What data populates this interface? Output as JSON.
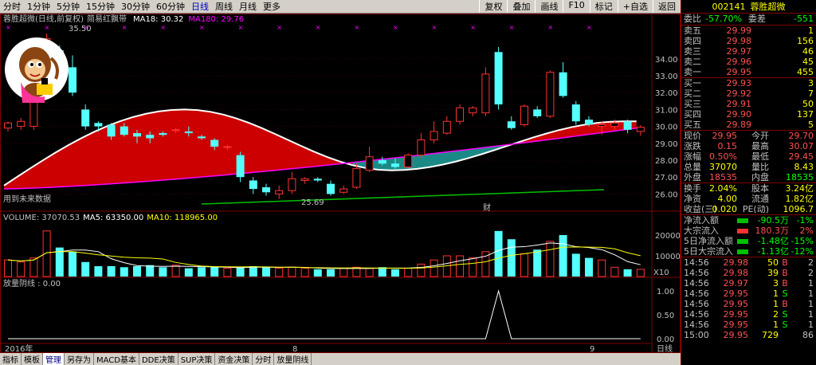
{
  "topbar": {
    "periods": [
      "分时",
      "1分钟",
      "5分钟",
      "15分钟",
      "30分钟",
      "60分钟",
      "日线",
      "周线",
      "月线",
      "更多"
    ],
    "active_period": "日线",
    "tools": [
      "复权",
      "叠加",
      "画线",
      "F10",
      "标记",
      "+自选",
      "返回"
    ]
  },
  "main_title": {
    "name": "蓉胜超微(日线,前复权)",
    "indicator": "简易红飘带",
    "ma18_label": "MA18: 30.32",
    "ma180_label": "MA180: 29.76"
  },
  "chart_labels": {
    "high_marker": "35.50",
    "low_marker": "25.69",
    "future_text": "用到未来数据",
    "cai_mark": "财",
    "volume_header": "VOLUME: 37070.53",
    "vol_ma5": "MA5: 63350.00",
    "vol_ma10": "MA10: 118965.00",
    "vol_unit": "X10",
    "ind_header": "放量阴线 : 0.00",
    "year_label": "2016年",
    "month_label_1": "8",
    "month_label_2": "9",
    "period_box": "日线"
  },
  "bottom_tabs": [
    "指标",
    "模板",
    "管理",
    "另存为",
    "MACD基本",
    "DDE决策",
    "SUP决策",
    "资金决策",
    "分时",
    "放量阴线"
  ],
  "active_tab": "管理",
  "colors": {
    "up": "#ff3232",
    "down": "#54ffff",
    "ribbon_red": "#cc0000",
    "ribbon_teal": "#1b8a87"
  },
  "quote": {
    "code": "002141",
    "name": "蓉胜超微",
    "weibi_label": "委比",
    "weibi_value": "-57.70%",
    "weicha_label": "委差",
    "weicha_value": "-551",
    "asks": [
      {
        "label": "卖五",
        "price": "29.99",
        "vol": "1"
      },
      {
        "label": "卖四",
        "price": "29.98",
        "vol": "156"
      },
      {
        "label": "卖三",
        "price": "29.97",
        "vol": "46"
      },
      {
        "label": "卖二",
        "price": "29.96",
        "vol": "45"
      },
      {
        "label": "卖一",
        "price": "29.95",
        "vol": "455"
      }
    ],
    "bids": [
      {
        "label": "买一",
        "price": "29.93",
        "vol": "3"
      },
      {
        "label": "买二",
        "price": "29.92",
        "vol": "7"
      },
      {
        "label": "买三",
        "price": "29.91",
        "vol": "50"
      },
      {
        "label": "买四",
        "price": "29.90",
        "vol": "137"
      },
      {
        "label": "买五",
        "price": "29.89",
        "vol": "5"
      }
    ],
    "stats": [
      {
        "l1": "现价",
        "v1": "29.95",
        "l2": "今开",
        "v2": "29.70"
      },
      {
        "l1": "涨跌",
        "v1": "0.15",
        "l2": "最高",
        "v2": "30.07"
      },
      {
        "l1": "涨幅",
        "v1": "0.50%",
        "l2": "最低",
        "v2": "29.45"
      },
      {
        "l1": "总量",
        "v1": "37070",
        "l2": "量比",
        "v2": "8.43"
      },
      {
        "l1": "外盘",
        "v1": "18535",
        "l2": "内盘",
        "v2": "18535"
      }
    ],
    "stats2": [
      {
        "l1": "换手",
        "v1": "2.04%",
        "l2": "股本",
        "v2": "3.24亿"
      },
      {
        "l1": "净资",
        "v1": "4.00",
        "l2": "流通",
        "v2": "1.82亿"
      },
      {
        "l1": "收益(三)",
        "v1": "0.020",
        "l2": "PE(动)",
        "v2": "1096.7"
      }
    ],
    "flows": [
      {
        "label": "净流入额",
        "value": "-90.5万",
        "pct": "-1%"
      },
      {
        "label": "大宗流入",
        "value": "180.3万",
        "pct": "2%"
      },
      {
        "label": "5日净流入额",
        "value": "-1.48亿",
        "pct": "-15%"
      },
      {
        "label": "5日大宗流入",
        "value": "-1.13亿",
        "pct": "-12%"
      }
    ],
    "ticks": [
      {
        "time": "14:56",
        "price": "29.98",
        "vol": "50",
        "bs": "B",
        "n": "2"
      },
      {
        "time": "14:56",
        "price": "29.98",
        "vol": "39",
        "bs": "B",
        "n": "2"
      },
      {
        "time": "14:56",
        "price": "29.97",
        "vol": "3",
        "bs": "B",
        "n": "1"
      },
      {
        "time": "14:56",
        "price": "29.95",
        "vol": "1",
        "bs": "S",
        "n": "1"
      },
      {
        "time": "14:56",
        "price": "29.95",
        "vol": "1",
        "bs": "B",
        "n": "1"
      },
      {
        "time": "14:56",
        "price": "29.95",
        "vol": "2",
        "bs": "S",
        "n": "1"
      },
      {
        "time": "14:56",
        "price": "29.95",
        "vol": "1",
        "bs": "S",
        "n": "1"
      },
      {
        "time": "15:00",
        "price": "29.95",
        "vol": "729",
        "bs": "",
        "n": "86"
      }
    ]
  },
  "chart_data": {
    "type": "candlestick",
    "price_axis": [
      34.0,
      33.0,
      32.0,
      31.0,
      30.0,
      29.0,
      28.0,
      27.0,
      26.0
    ],
    "volume_axis": [
      20000,
      10000
    ],
    "indicator_axis": [
      1.0,
      0.5,
      0.0
    ],
    "candles": [
      {
        "o": 29.9,
        "c": 30.2,
        "h": 30.3,
        "l": 29.7
      },
      {
        "o": 30.0,
        "c": 30.3,
        "h": 30.5,
        "l": 29.8
      },
      {
        "o": 30.0,
        "c": 34.0,
        "h": 34.5,
        "l": 29.8
      },
      {
        "o": 34.5,
        "c": 35.2,
        "h": 35.5,
        "l": 33.5
      },
      {
        "o": 34.5,
        "c": 32.5,
        "h": 34.8,
        "l": 32.2
      },
      {
        "o": 33.5,
        "c": 32.0,
        "h": 34.2,
        "l": 31.8
      },
      {
        "o": 31.0,
        "c": 30.0,
        "h": 31.3,
        "l": 29.8
      },
      {
        "o": 30.2,
        "c": 30.0,
        "h": 30.3,
        "l": 29.7
      },
      {
        "o": 30.1,
        "c": 29.4,
        "h": 30.2,
        "l": 29.2
      },
      {
        "o": 30.0,
        "c": 29.5,
        "h": 30.2,
        "l": 29.4
      },
      {
        "o": 29.6,
        "c": 29.4,
        "h": 29.8,
        "l": 29.0
      },
      {
        "o": 29.5,
        "c": 29.3,
        "h": 29.7,
        "l": 29.0
      },
      {
        "o": 29.6,
        "c": 29.5,
        "h": 29.7,
        "l": 29.4
      },
      {
        "o": 29.8,
        "c": 29.8,
        "h": 29.9,
        "l": 29.6
      },
      {
        "o": 29.7,
        "c": 29.6,
        "h": 30.0,
        "l": 29.4
      },
      {
        "o": 29.4,
        "c": 29.3,
        "h": 29.5,
        "l": 29.2
      },
      {
        "o": 29.2,
        "c": 28.8,
        "h": 29.3,
        "l": 28.6
      },
      {
        "o": 28.8,
        "c": 28.8,
        "h": 28.9,
        "l": 28.6
      },
      {
        "o": 28.3,
        "c": 27.0,
        "h": 28.5,
        "l": 26.7
      },
      {
        "o": 26.8,
        "c": 26.3,
        "h": 27.0,
        "l": 26.0
      },
      {
        "o": 26.4,
        "c": 26.1,
        "h": 26.6,
        "l": 25.9
      },
      {
        "o": 26.0,
        "c": 26.2,
        "h": 26.5,
        "l": 25.7
      },
      {
        "o": 26.2,
        "c": 26.9,
        "h": 27.3,
        "l": 26.0
      },
      {
        "o": 26.8,
        "c": 26.9,
        "h": 27.0,
        "l": 26.6
      },
      {
        "o": 26.9,
        "c": 26.8,
        "h": 27.0,
        "l": 26.7
      },
      {
        "o": 26.6,
        "c": 26.0,
        "h": 26.8,
        "l": 25.9
      },
      {
        "o": 26.1,
        "c": 26.3,
        "h": 26.5,
        "l": 26.0
      },
      {
        "o": 26.4,
        "c": 27.5,
        "h": 27.8,
        "l": 26.3
      },
      {
        "o": 27.4,
        "c": 28.2,
        "h": 28.8,
        "l": 27.3
      },
      {
        "o": 28.0,
        "c": 27.8,
        "h": 28.2,
        "l": 27.7
      },
      {
        "o": 27.8,
        "c": 27.6,
        "h": 28.1,
        "l": 27.5
      },
      {
        "o": 27.6,
        "c": 28.3,
        "h": 28.4,
        "l": 27.5
      },
      {
        "o": 28.3,
        "c": 29.2,
        "h": 29.6,
        "l": 28.1
      },
      {
        "o": 29.2,
        "c": 29.7,
        "h": 30.3,
        "l": 29.0
      },
      {
        "o": 29.6,
        "c": 30.3,
        "h": 30.6,
        "l": 29.5
      },
      {
        "o": 30.3,
        "c": 31.1,
        "h": 31.3,
        "l": 30.1
      },
      {
        "o": 30.8,
        "c": 31.1,
        "h": 31.2,
        "l": 30.6
      },
      {
        "o": 30.8,
        "c": 33.1,
        "h": 33.5,
        "l": 30.6
      },
      {
        "o": 34.4,
        "c": 31.3,
        "h": 34.7,
        "l": 31.0
      },
      {
        "o": 30.3,
        "c": 29.9,
        "h": 30.6,
        "l": 29.8
      },
      {
        "o": 30.1,
        "c": 31.2,
        "h": 31.3,
        "l": 30.0
      },
      {
        "o": 31.0,
        "c": 30.6,
        "h": 31.2,
        "l": 30.5
      },
      {
        "o": 30.6,
        "c": 33.2,
        "h": 33.3,
        "l": 30.5
      },
      {
        "o": 33.2,
        "c": 31.8,
        "h": 33.8,
        "l": 31.7
      },
      {
        "o": 31.3,
        "c": 30.3,
        "h": 31.5,
        "l": 30.1
      },
      {
        "o": 30.4,
        "c": 30.1,
        "h": 30.6,
        "l": 30.0
      },
      {
        "o": 30.0,
        "c": 30.1,
        "h": 30.3,
        "l": 29.5
      },
      {
        "o": 30.0,
        "c": 30.2,
        "h": 30.4,
        "l": 29.8
      },
      {
        "o": 30.3,
        "c": 29.8,
        "h": 30.4,
        "l": 29.6
      },
      {
        "o": 29.7,
        "c": 29.95,
        "h": 30.07,
        "l": 29.45
      }
    ],
    "volumes": [
      8000,
      7000,
      9000,
      22000,
      14000,
      12000,
      7000,
      5000,
      5000,
      4500,
      5000,
      5500,
      4500,
      5500,
      4000,
      4500,
      4500,
      4000,
      4500,
      5000,
      4500,
      4000,
      4500,
      4000,
      3500,
      3500,
      4000,
      4500,
      4000,
      4500,
      3500,
      4000,
      6000,
      8000,
      10000,
      10000,
      9000,
      12000,
      22000,
      18000,
      11000,
      13000,
      17000,
      20000,
      11000,
      9000,
      8000,
      4500,
      3500,
      3500
    ],
    "indicator": [
      0,
      0,
      0,
      0,
      0,
      0,
      0,
      0,
      0,
      0,
      0,
      0,
      0,
      0,
      0,
      0,
      0,
      0,
      0,
      0,
      0,
      0,
      0,
      0,
      0,
      0,
      0,
      0,
      0,
      0,
      0,
      0,
      0,
      0,
      0,
      0,
      0,
      0,
      1,
      0,
      0,
      0,
      0,
      0,
      0,
      0,
      0,
      0,
      0,
      0
    ]
  }
}
